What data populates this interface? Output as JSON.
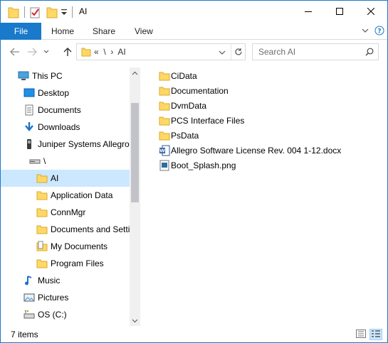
{
  "window": {
    "title": "AI",
    "buttons": [
      "minimize",
      "maximize",
      "close"
    ]
  },
  "ribbon": {
    "tabs": [
      {
        "label": "File",
        "active": true
      },
      {
        "label": "Home"
      },
      {
        "label": "Share"
      },
      {
        "label": "View"
      }
    ]
  },
  "address": {
    "path": "«  \\  ›  AI"
  },
  "search": {
    "placeholder": "Search AI"
  },
  "nav": {
    "items": [
      {
        "label": "This PC",
        "icon": "computer-icon",
        "level": 0
      },
      {
        "label": "Desktop",
        "icon": "desktop-icon",
        "level": 1
      },
      {
        "label": "Documents",
        "icon": "documents-icon",
        "level": 1
      },
      {
        "label": "Downloads",
        "icon": "downloads-icon",
        "level": 1
      },
      {
        "label": "Juniper Systems Allegro",
        "icon": "device-icon",
        "level": 1
      },
      {
        "label": "\\",
        "icon": "drive-icon",
        "level": 2
      },
      {
        "label": "AI",
        "icon": "folder-icon",
        "level": 3,
        "selected": true
      },
      {
        "label": "Application Data",
        "icon": "folder-icon",
        "level": 3
      },
      {
        "label": "ConnMgr",
        "icon": "folder-icon",
        "level": 3
      },
      {
        "label": "Documents and Setti",
        "icon": "folder-icon",
        "level": 3
      },
      {
        "label": "My Documents",
        "icon": "special-folder-icon",
        "level": 3
      },
      {
        "label": "Program Files",
        "icon": "folder-icon",
        "level": 3
      },
      {
        "label": "Music",
        "icon": "music-icon",
        "level": 1
      },
      {
        "label": "Pictures",
        "icon": "pictures-icon",
        "level": 1
      },
      {
        "label": "OS (C:)",
        "icon": "os-drive-icon",
        "level": 1
      }
    ]
  },
  "files": [
    {
      "name": "CiData",
      "icon": "folder-icon"
    },
    {
      "name": "Documentation",
      "icon": "folder-icon"
    },
    {
      "name": "DvmData",
      "icon": "folder-icon"
    },
    {
      "name": "PCS Interface Files",
      "icon": "folder-icon"
    },
    {
      "name": "PsData",
      "icon": "folder-icon"
    },
    {
      "name": "Allegro Software License Rev. 004 1-12.docx",
      "icon": "word-doc-icon"
    },
    {
      "name": "Boot_Splash.png",
      "icon": "image-file-icon"
    }
  ],
  "status": {
    "count": "7 items"
  },
  "colors": {
    "accent": "#1979ca",
    "selection": "#cce8ff",
    "folder": "#ffd865"
  }
}
